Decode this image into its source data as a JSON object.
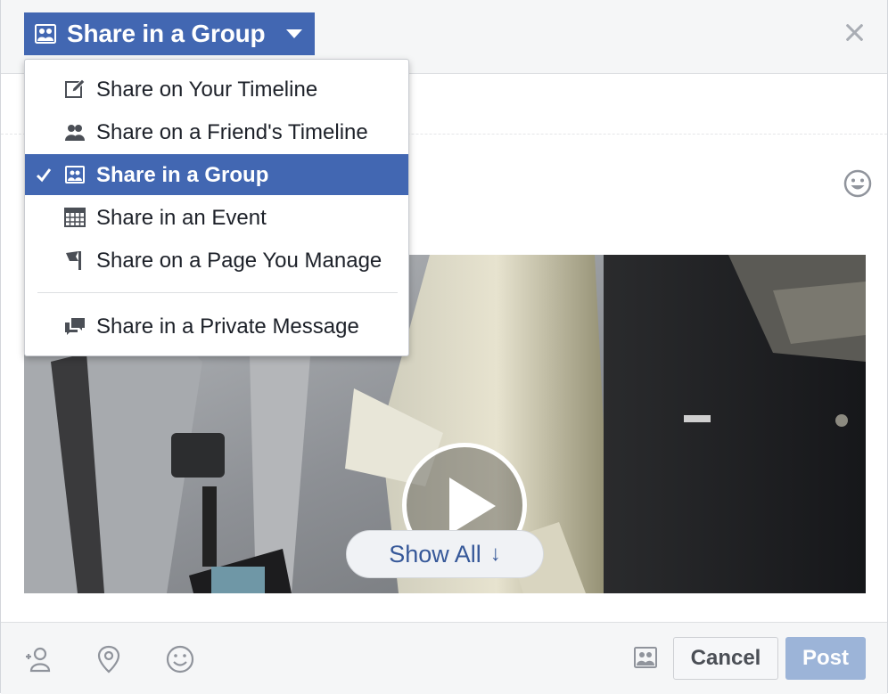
{
  "header": {
    "share_button_label": "Share in a Group"
  },
  "menu": {
    "items": [
      {
        "label": "Share on Your Timeline",
        "icon": "pencil-icon"
      },
      {
        "label": "Share on a Friend's Timeline",
        "icon": "friends-icon"
      },
      {
        "label": "Share in a Group",
        "icon": "group-icon",
        "selected": true
      },
      {
        "label": "Share in an Event",
        "icon": "calendar-icon"
      },
      {
        "label": "Share on a Page You Manage",
        "icon": "flag-icon"
      },
      {
        "label": "Share in a Private Message",
        "icon": "message-icon"
      }
    ]
  },
  "media": {
    "show_all_label": "Show All",
    "show_all_arrow": "↓"
  },
  "footer": {
    "cancel_label": "Cancel",
    "post_label": "Post"
  },
  "colors": {
    "brand_blue": "#4267b2",
    "post_disabled": "#9cb4d8",
    "link_blue": "#365899"
  }
}
